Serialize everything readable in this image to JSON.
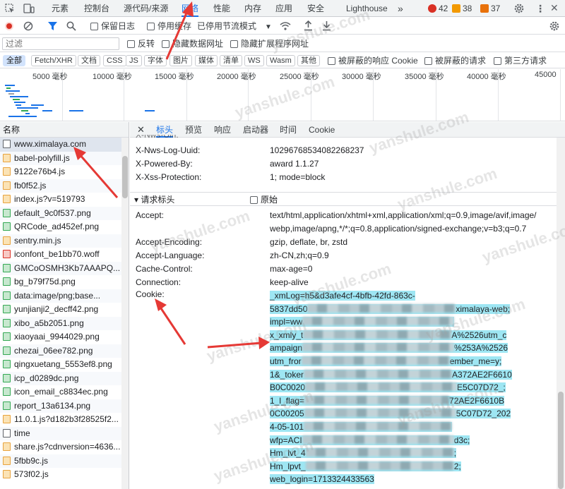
{
  "tabs": [
    {
      "label": "元素",
      "x": 0
    },
    {
      "label": "控制台",
      "x": 0
    },
    {
      "label": "源代码/来源",
      "x": 0
    },
    {
      "label": "网络",
      "x": 0
    },
    {
      "label": "性能",
      "x": 0
    },
    {
      "label": "内存",
      "x": 0
    },
    {
      "label": "应用",
      "x": 0
    },
    {
      "label": "安全",
      "x": 0
    },
    {
      "label": "Lighthouse",
      "x": 0
    }
  ],
  "more_tabs": "»",
  "counters": {
    "errors": "42",
    "warnings": "38",
    "issues": "37"
  },
  "toolbar": {
    "preserve_log": "保留日志",
    "disable_cache": "停用缓存",
    "throttling": "已停用节流模式"
  },
  "filter": {
    "placeholder": "过滤",
    "invert": "反转",
    "hide_data_urls": "隐藏数据网址",
    "hide_extension_urls": "隐藏扩展程序网址"
  },
  "types": [
    "全部",
    "Fetch/XHR",
    "文档",
    "CSS",
    "JS",
    "字体",
    "图片",
    "媒体",
    "清单",
    "WS",
    "Wasm",
    "其他"
  ],
  "type_options": {
    "blocked_cookies": "被屏蔽的响应 Cookie",
    "blocked_requests": "被屏蔽的请求",
    "third_party": "第三方请求"
  },
  "timeline_ticks": [
    "5000 毫秒",
    "10000 毫秒",
    "15000 毫秒",
    "20000 毫秒",
    "25000 毫秒",
    "30000 毫秒",
    "35000 毫秒",
    "40000 毫秒",
    "45000"
  ],
  "list_header": "名称",
  "requests": [
    {
      "name": "www.ximalaya.com",
      "icon": "document-icon"
    },
    {
      "name": "babel-polyfill.js",
      "icon": "script-icon"
    },
    {
      "name": "9122e76b4.js",
      "icon": "script-icon"
    },
    {
      "name": "fb0f52.js",
      "icon": "script-icon"
    },
    {
      "name": "index.js?v=519793",
      "icon": "script-icon"
    },
    {
      "name": "default_9c0f537.png",
      "icon": "image-icon"
    },
    {
      "name": "QRCode_ad452ef.png",
      "icon": "image-icon"
    },
    {
      "name": "sentry.min.js",
      "icon": "script-icon"
    },
    {
      "name": "iconfont_be1bb70.woff",
      "icon": "font-icon"
    },
    {
      "name": "GMCoOSMH3Kb7AAAPQ...",
      "icon": "image-icon"
    },
    {
      "name": "bg_b79f75d.png",
      "icon": "image-icon"
    },
    {
      "name": "data:image/png;base...",
      "icon": "image-icon"
    },
    {
      "name": "yunjianji2_decff42.png",
      "icon": "image-icon"
    },
    {
      "name": "xibo_a5b2051.png",
      "icon": "image-icon"
    },
    {
      "name": "xiaoyaai_9944029.png",
      "icon": "image-icon"
    },
    {
      "name": "chezai_06ee782.png",
      "icon": "image-icon"
    },
    {
      "name": "qingxuetang_5553ef8.png",
      "icon": "image-icon"
    },
    {
      "name": "icp_d0289dc.png",
      "icon": "image-icon"
    },
    {
      "name": "icon_email_c8834ec.png",
      "icon": "image-icon"
    },
    {
      "name": "report_13a6134.png",
      "icon": "image-icon"
    },
    {
      "name": "11.0.1.js?d182b3f28525f2...",
      "icon": "script-icon"
    },
    {
      "name": "time",
      "icon": "document-icon"
    },
    {
      "name": "share.js?cdnversion=4636...",
      "icon": "script-icon"
    },
    {
      "name": "5fbb9c.js",
      "icon": "script-icon"
    },
    {
      "name": "573f02.js",
      "icon": "script-icon"
    }
  ],
  "detail_tabs": [
    "标头",
    "预览",
    "响应",
    "启动器",
    "时间",
    "Cookie"
  ],
  "response_headers": [
    {
      "key": "X-Nws-Log-Uuid:",
      "value": "10296768534082268237"
    },
    {
      "key": "X-Powered-By:",
      "value": "award 1.1.27"
    },
    {
      "key": "X-Xss-Protection:",
      "value": "1; mode=block"
    }
  ],
  "request_section": {
    "title": "▾ 请求标头",
    "raw": "原始"
  },
  "request_headers": [
    {
      "key": "Accept:",
      "lines": [
        "text/html,application/xhtml+xml,application/xml;q=0.9,image/avif,image/",
        "webp,image/apng,*/*;q=0.8,application/signed-exchange;v=b3;q=0.7"
      ]
    },
    {
      "key": "Accept-Encoding:",
      "lines": [
        "gzip, deflate, br, zstd"
      ]
    },
    {
      "key": "Accept-Language:",
      "lines": [
        "zh-CN,zh;q=0.9"
      ]
    },
    {
      "key": "Cache-Control:",
      "lines": [
        "max-age=0"
      ]
    },
    {
      "key": "Connection:",
      "lines": [
        "keep-alive"
      ]
    }
  ],
  "cookie": {
    "key": "Cookie:",
    "lines": [
      {
        "left": "_xmLog=h5&d3afe4cf-4bfb-42fd-863c-",
        "right": ""
      },
      {
        "left": "5837dd50",
        "right": "ximalaya-web;"
      },
      {
        "left": "impl=ww",
        "right": ""
      },
      {
        "left": "x_xmly_t",
        "right": "A%2526utm_c"
      },
      {
        "left": "ampaign",
        "right": "%253A%2526"
      },
      {
        "left": "utm_fror",
        "right": "ember_me=y;"
      },
      {
        "left": "1&_toker",
        "right": "A372AE2F6610"
      },
      {
        "left": "B0C0020",
        "right": "E5C07D72_;"
      },
      {
        "left": "1_l_flag=",
        "right": "72AE2F6610B"
      },
      {
        "left": "0C00205",
        "right": "5C07D72_202"
      },
      {
        "left": "4-05-101",
        "right": ""
      },
      {
        "left": "wfp=ACI",
        "right": "d3c;"
      },
      {
        "left": "Hm_lvt_4",
        "right": ";"
      },
      {
        "left": "Hm_lpvt_",
        "right": "2;"
      },
      {
        "left": "web_login=1713324433563",
        "right": ""
      }
    ]
  },
  "watermark": "yanshule.com",
  "colors": {
    "accent": "#1a73e8",
    "highlight": "#9ee6f3",
    "arrow": "#e53935"
  }
}
